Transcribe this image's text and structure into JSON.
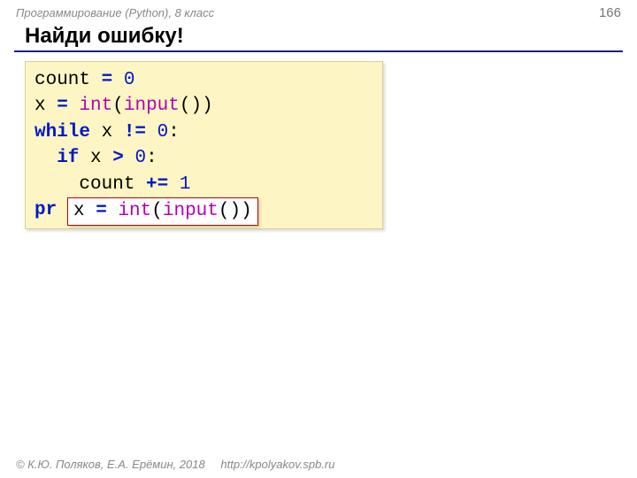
{
  "header": {
    "course": "Программирование (Python), 8 класс",
    "page": "166"
  },
  "title": "Найди ошибку!",
  "code": {
    "l1a": "count ",
    "l1b": "=",
    "l1c": " 0",
    "l2a": "x ",
    "l2b": "=",
    "l2c": " int",
    "l2d": "(",
    "l2e": "input",
    "l2f": "())",
    "l3a": "while",
    "l3b": " x ",
    "l3c": "!=",
    "l3d": " 0",
    "l3e": ":",
    "l4a": "  if",
    "l4b": " x ",
    "l4c": ">",
    "l4d": " 0",
    "l4e": ":",
    "l5a": "    count ",
    "l5b": "+=",
    "l5c": " 1",
    "l6a": "pr"
  },
  "overlay": {
    "a": "x ",
    "b": "=",
    "c": " int",
    "d": "(",
    "e": "input",
    "f": "())"
  },
  "footer": {
    "copyright": "© К.Ю. Поляков, Е.А. Ерёмин, 2018",
    "url": "http://kpolyakov.spb.ru"
  }
}
